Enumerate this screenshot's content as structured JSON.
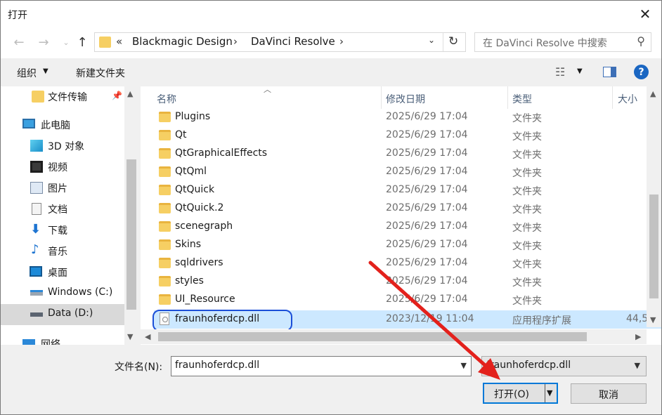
{
  "title": "打开",
  "nav": {
    "back_icon": "arrow-left-icon",
    "forward_icon": "arrow-right-icon",
    "recent_icon": "chevron-down-icon",
    "up_icon": "arrow-up-icon",
    "address_prefix": "«",
    "crumbs": [
      "Blackmagic Design",
      "DaVinci Resolve"
    ],
    "search_placeholder": "在 DaVinci Resolve 中搜索"
  },
  "toolbar": {
    "organize": "组织",
    "new_folder": "新建文件夹"
  },
  "sidebar": {
    "items": [
      {
        "label": "文件传输",
        "icon": "folder-icon"
      },
      {
        "label": "此电脑",
        "icon": "computer-icon"
      },
      {
        "label": "3D 对象",
        "icon": "3d-objects-icon"
      },
      {
        "label": "视频",
        "icon": "video-icon"
      },
      {
        "label": "图片",
        "icon": "pictures-icon"
      },
      {
        "label": "文档",
        "icon": "documents-icon"
      },
      {
        "label": "下载",
        "icon": "download-icon"
      },
      {
        "label": "音乐",
        "icon": "music-icon"
      },
      {
        "label": "桌面",
        "icon": "desktop-icon"
      },
      {
        "label": "Windows (C:)",
        "icon": "drive-icon"
      },
      {
        "label": "Data (D:)",
        "icon": "drive-icon"
      },
      {
        "label": "网络",
        "icon": "network-icon"
      }
    ],
    "selected": "Data (D:)"
  },
  "columns": {
    "name": "名称",
    "date": "修改日期",
    "type": "类型",
    "size": "大小"
  },
  "files": [
    {
      "name": "Plugins",
      "date": "2025/6/29 17:04",
      "type": "文件夹",
      "size": ""
    },
    {
      "name": "Qt",
      "date": "2025/6/29 17:04",
      "type": "文件夹",
      "size": ""
    },
    {
      "name": "QtGraphicalEffects",
      "date": "2025/6/29 17:04",
      "type": "文件夹",
      "size": ""
    },
    {
      "name": "QtQml",
      "date": "2025/6/29 17:04",
      "type": "文件夹",
      "size": ""
    },
    {
      "name": "QtQuick",
      "date": "2025/6/29 17:04",
      "type": "文件夹",
      "size": ""
    },
    {
      "name": "QtQuick.2",
      "date": "2025/6/29 17:04",
      "type": "文件夹",
      "size": ""
    },
    {
      "name": "scenegraph",
      "date": "2025/6/29 17:04",
      "type": "文件夹",
      "size": ""
    },
    {
      "name": "Skins",
      "date": "2025/6/29 17:04",
      "type": "文件夹",
      "size": ""
    },
    {
      "name": "sqldrivers",
      "date": "2025/6/29 17:04",
      "type": "文件夹",
      "size": ""
    },
    {
      "name": "styles",
      "date": "2025/6/29 17:04",
      "type": "文件夹",
      "size": ""
    },
    {
      "name": "UI_Resource",
      "date": "2025/6/29 17:04",
      "type": "文件夹",
      "size": ""
    },
    {
      "name": "fraunhoferdcp.dll",
      "date": "2023/12/19 11:04",
      "type": "应用程序扩展",
      "size": "44,5"
    }
  ],
  "bottom": {
    "filename_label": "文件名(N):",
    "filename_value": "fraunhoferdcp.dll",
    "filetype_value": "fraunhoferdcp.dll",
    "open": "打开(O)",
    "cancel": "取消"
  },
  "colors": {
    "accent": "#0078d7",
    "selection": "#cce8ff",
    "folder": "#f6cf63",
    "annotation_arrow": "#e3211c",
    "annotation_oval": "#1b4fd8"
  }
}
